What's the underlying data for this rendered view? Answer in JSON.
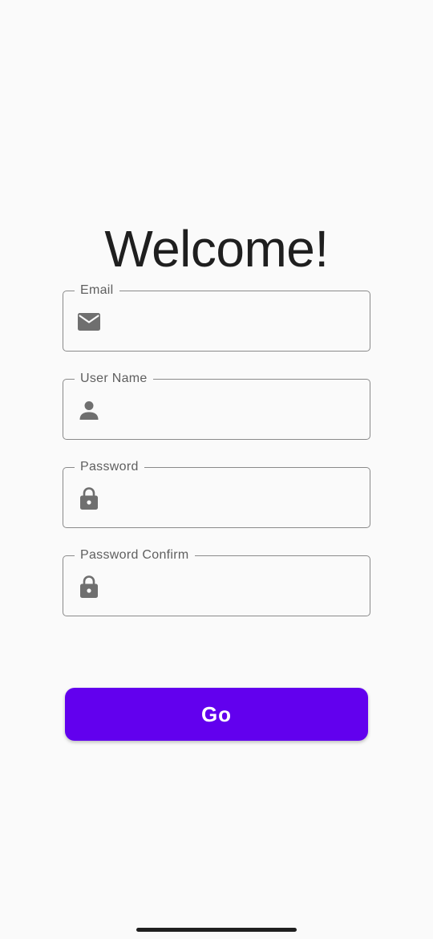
{
  "header": {
    "title": "Welcome!"
  },
  "form": {
    "fields": [
      {
        "label": "Email",
        "value": "",
        "icon": "email-icon"
      },
      {
        "label": "User Name",
        "value": "",
        "icon": "person-icon"
      },
      {
        "label": "Password",
        "value": "",
        "icon": "lock-icon"
      },
      {
        "label": "Password Confirm",
        "value": "",
        "icon": "lock-icon"
      }
    ],
    "submit_label": "Go"
  },
  "colors": {
    "accent": "#6200ee",
    "background": "#fafafa",
    "outline": "#8a8a8a",
    "icon": "#6f6f6f",
    "text": "#1f1f1f"
  }
}
